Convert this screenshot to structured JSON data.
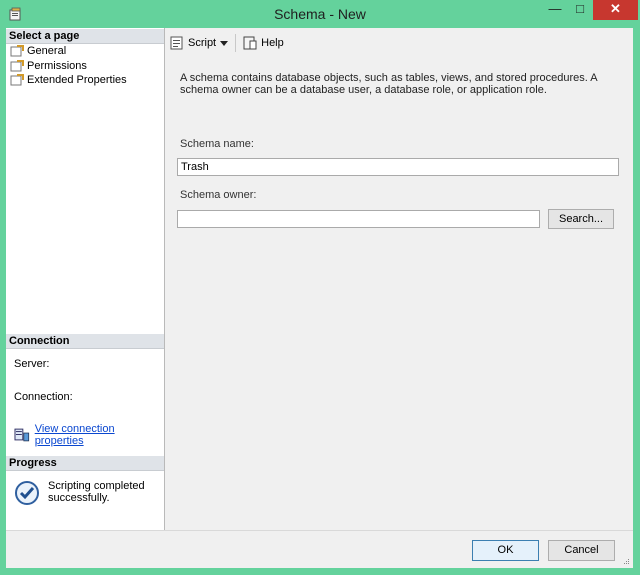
{
  "window": {
    "title": "Schema - New",
    "minimize_glyph": "—",
    "maximize_glyph": "□",
    "close_glyph": "✕"
  },
  "left": {
    "select_page_header": "Select a page",
    "pages": [
      {
        "label": "General",
        "icon": "wrench-page-icon"
      },
      {
        "label": "Permissions",
        "icon": "wrench-page-icon"
      },
      {
        "label": "Extended Properties",
        "icon": "wrench-page-icon"
      }
    ],
    "connection_header": "Connection",
    "server_label": "Server:",
    "connection_label": "Connection:",
    "view_connection_properties": "View connection properties",
    "progress_header": "Progress",
    "progress_status": "Scripting completed successfully."
  },
  "toolbar": {
    "script_label": "Script",
    "help_label": "Help"
  },
  "main": {
    "description": "A schema contains database objects, such as tables, views, and stored procedures. A schema owner can be a database user, a database role, or application role.",
    "schema_name_label": "Schema name:",
    "schema_name_value": "Trash",
    "schema_owner_label": "Schema owner:",
    "schema_owner_value": "",
    "search_label": "Search..."
  },
  "footer": {
    "ok_label": "OK",
    "cancel_label": "Cancel"
  },
  "colors": {
    "window_frame": "#64d29c",
    "close_button": "#c7372f",
    "link": "#0a47d0"
  }
}
